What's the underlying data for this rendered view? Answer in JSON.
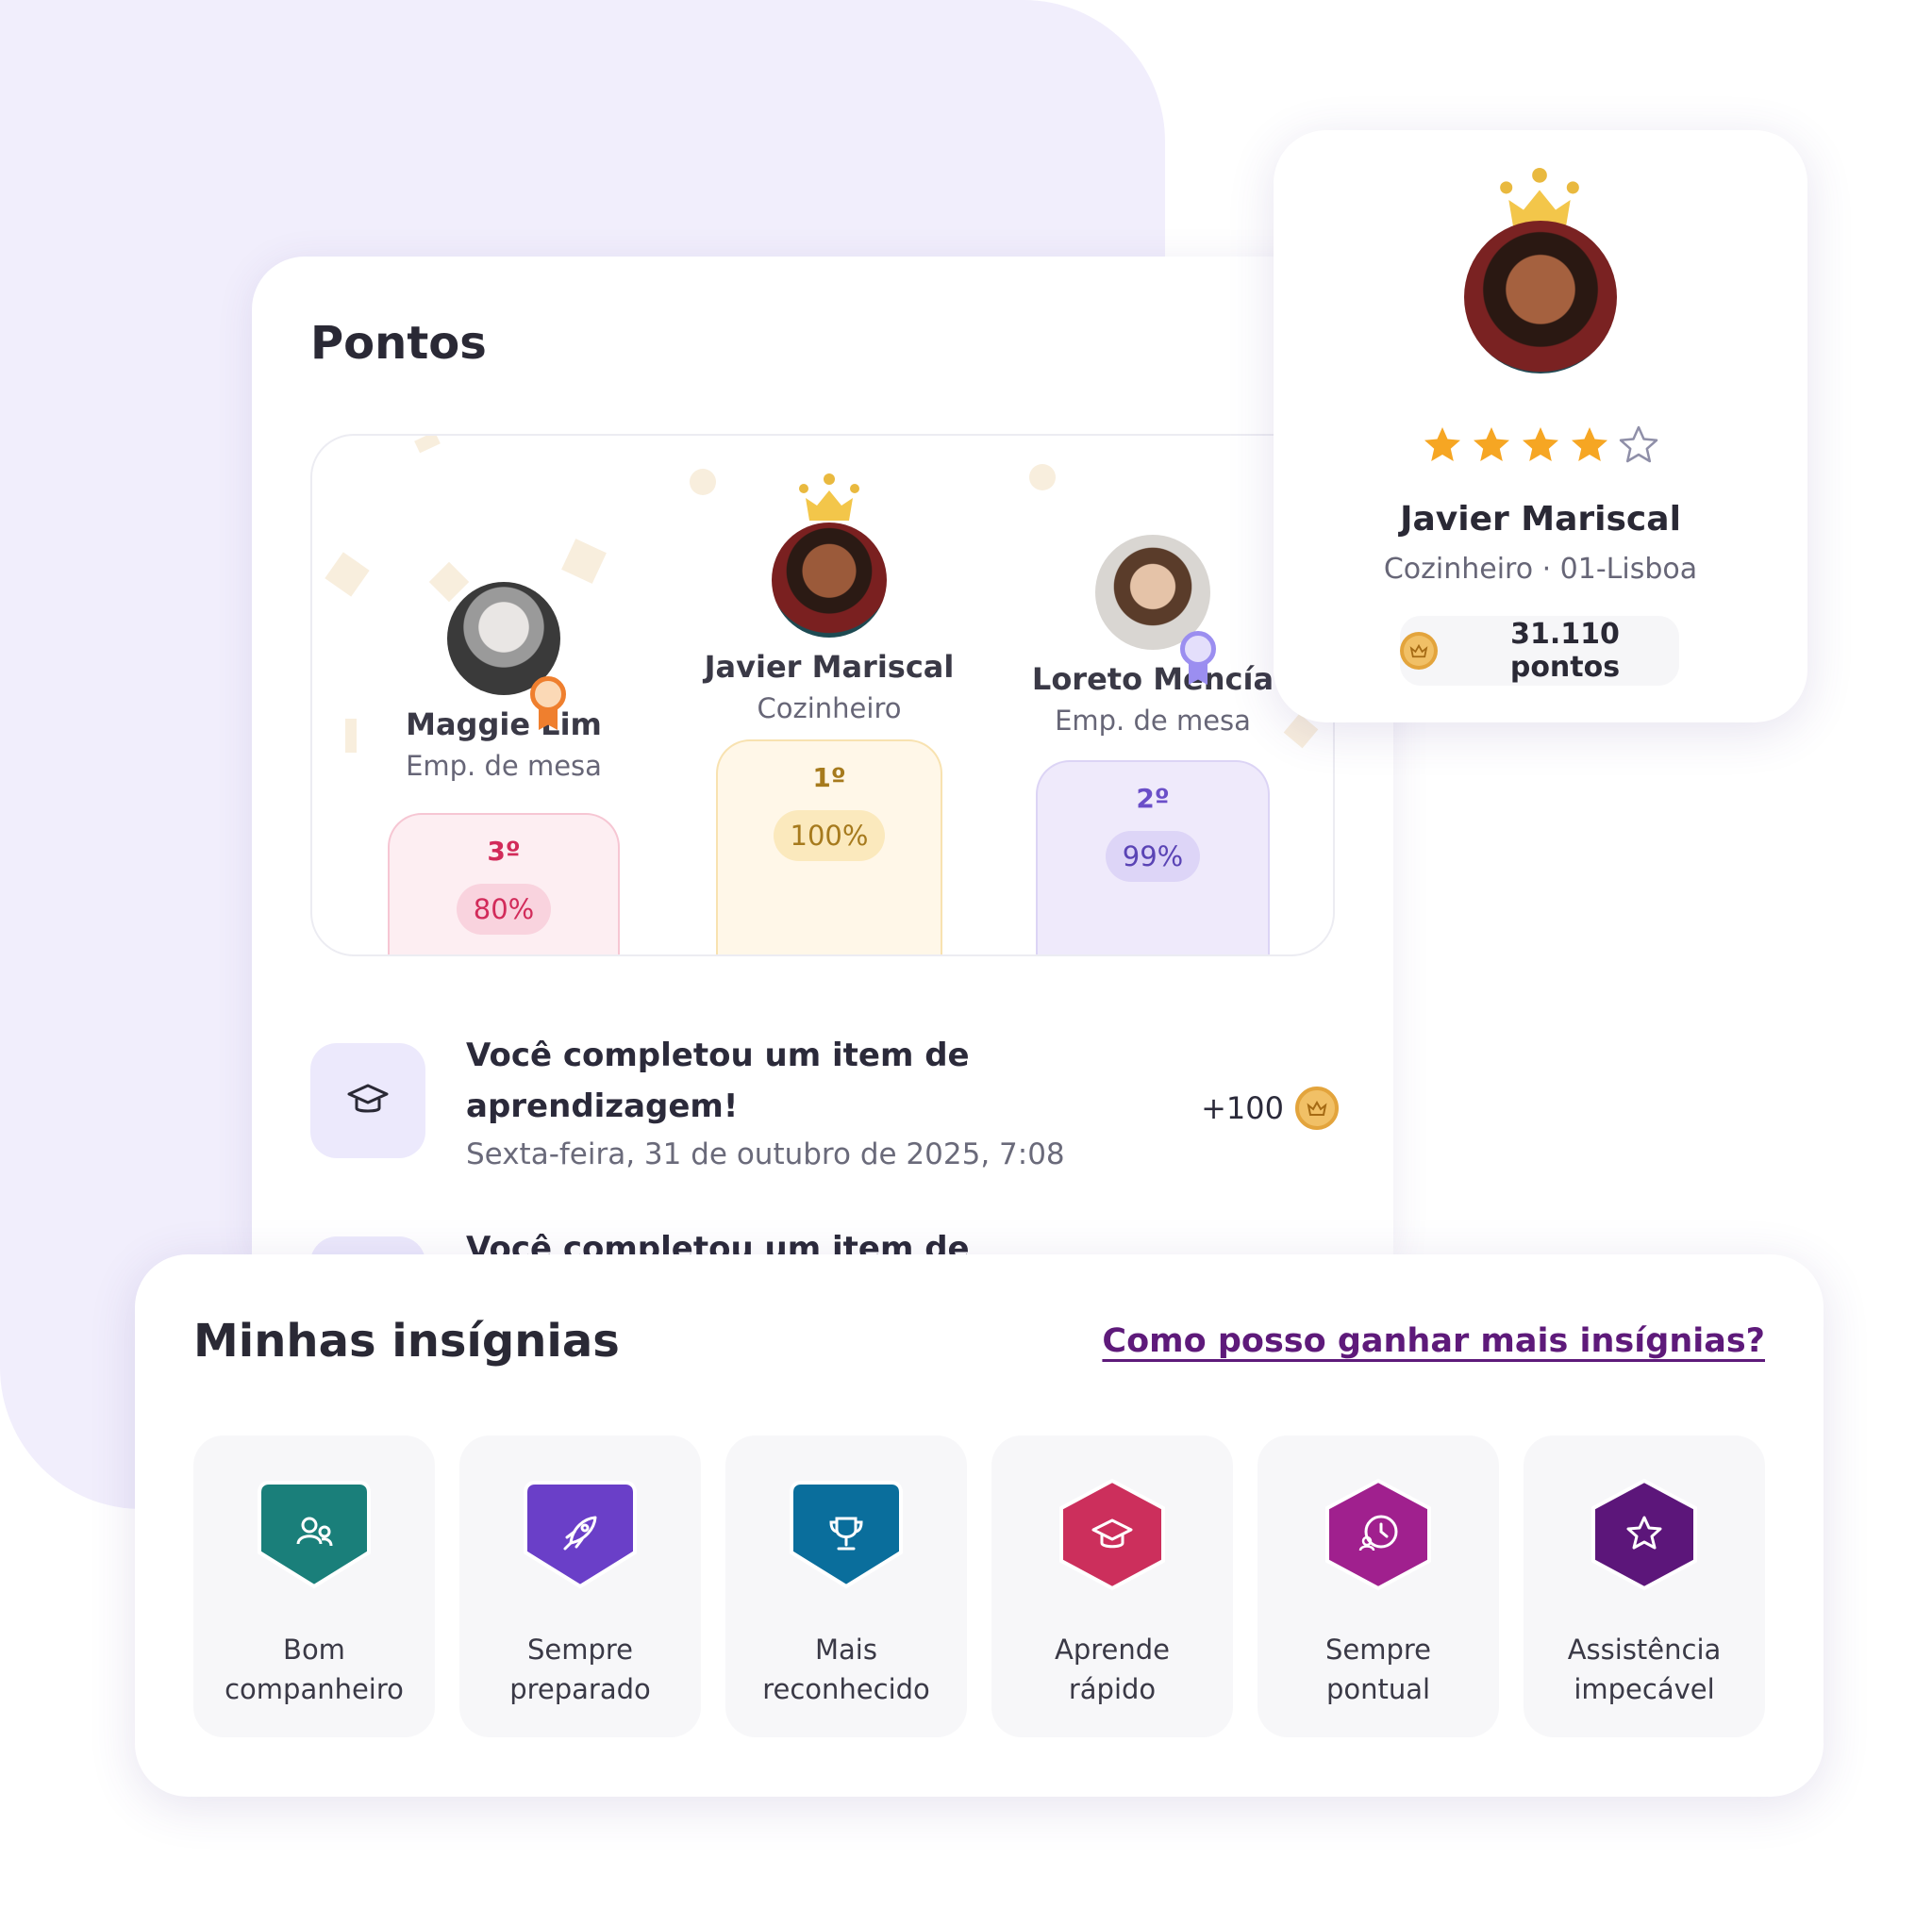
{
  "points_panel": {
    "title": "Pontos",
    "podium": [
      {
        "rank": "3º",
        "name": "Maggie Lim",
        "role": "Emp. de mesa",
        "percent": "80%"
      },
      {
        "rank": "1º",
        "name": "Javier Mariscal",
        "role": "Cozinheiro",
        "percent": "100%"
      },
      {
        "rank": "2º",
        "name": "Loreto Mencía",
        "role": "Emp. de mesa",
        "percent": "99%"
      }
    ],
    "activities": [
      {
        "title": "Você completou um item de aprendizagem!",
        "date": "Sexta-feira, 31 de outubro de 2025, 7:08",
        "points": "+100"
      },
      {
        "title": "Você completou um item de"
      }
    ]
  },
  "profile": {
    "name": "Javier Mariscal",
    "role": "Cozinheiro · 01-Lisboa",
    "rating": 4,
    "rating_max": 5,
    "points": "31.110 pontos"
  },
  "badges": {
    "title": "Minhas insígnias",
    "link": "Como posso ganhar mais insígnias?",
    "items": [
      {
        "label": "Bom\ncompanheiro",
        "icon": "users-icon",
        "color": "#1a7f7a"
      },
      {
        "label": "Sempre\npreparado",
        "icon": "rocket-icon",
        "color": "#6a3fc8"
      },
      {
        "label": "Mais\nreconhecido",
        "icon": "trophy-icon",
        "color": "#0a6e9c"
      },
      {
        "label": "Aprende\nrápido",
        "icon": "graduation-cap-icon",
        "color": "#cc2f5c"
      },
      {
        "label": "Sempre\npontual",
        "icon": "clock-user-icon",
        "color": "#a0208e"
      },
      {
        "label": "Assistência\nimpecável",
        "icon": "star-icon",
        "color": "#5c167a"
      }
    ]
  },
  "colors": {
    "background_blob": "#f1eefc",
    "gold": "#e9b93f",
    "link": "#5e1a7a"
  }
}
